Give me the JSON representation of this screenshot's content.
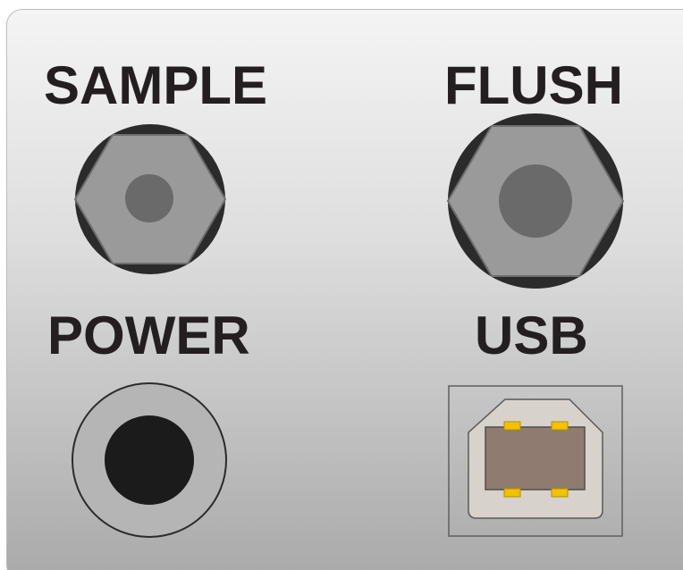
{
  "labels": {
    "sample": "SAMPLE",
    "flush": "FLUSH",
    "power": "POWER",
    "usb": "USB"
  },
  "colors": {
    "panel_top": "#f4f4f4",
    "panel_bottom": "#a9a9a9",
    "label_text": "#231f20",
    "fitting_ring": "#2b2b2b",
    "fitting_hex": "#9a9a9a",
    "fitting_center": "#6a6a6a",
    "power_jack": "#1b1b1b",
    "usb_body": "#d8d2cc",
    "usb_socket": "#8f7b6f",
    "usb_pins": "#f2c200"
  },
  "icons": {
    "sample_port": "hex-fitting-icon",
    "flush_port": "hex-fitting-icon",
    "power_port": "barrel-jack-icon",
    "usb_port": "usb-b-port-icon"
  }
}
